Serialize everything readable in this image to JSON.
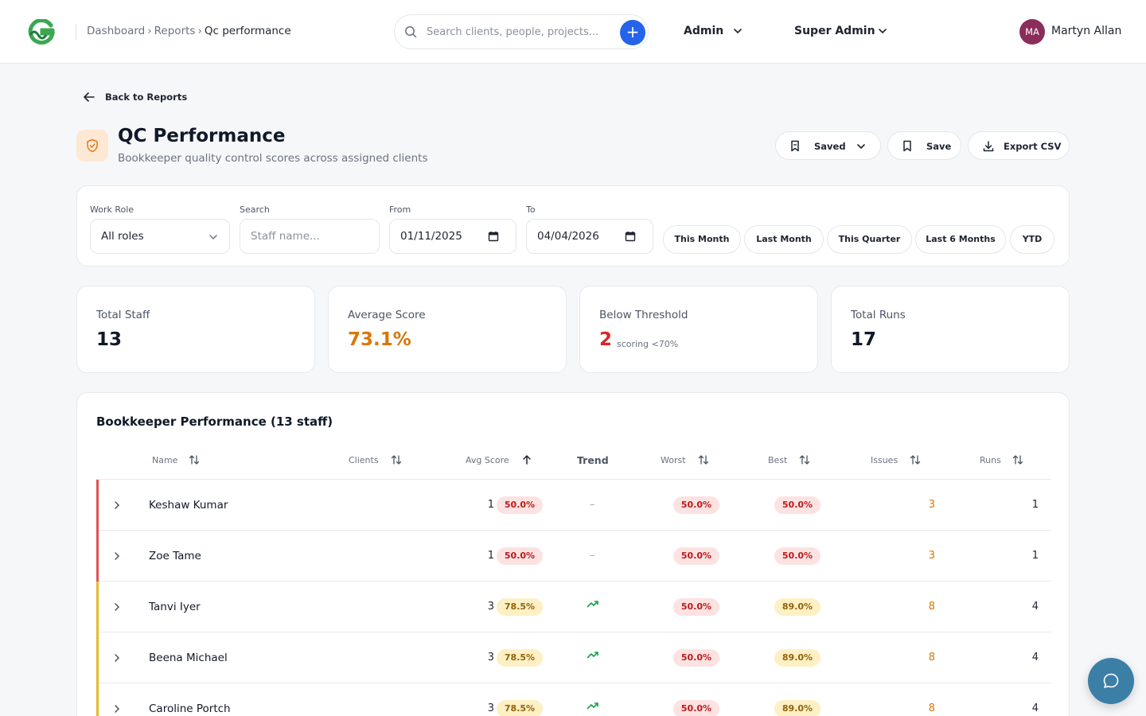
{
  "header": {
    "breadcrumb": [
      "Dashboard",
      "Reports",
      "Qc performance"
    ],
    "breadcrumb_sep": "›",
    "search_placeholder": "Search clients, people, projects...",
    "menu_admin": "Admin",
    "menu_super_admin": "Super Admin",
    "user_initials": "MA",
    "user_name": "Martyn Allan"
  },
  "page": {
    "back_label": "Back to Reports",
    "title": "QC Performance",
    "subtitle": "Bookkeeper quality control scores across assigned clients",
    "saved_label": "Saved",
    "save_label": "Save",
    "export_label": "Export CSV"
  },
  "filters": {
    "work_role_label": "Work Role",
    "work_role_value": "All roles",
    "search_label": "Search",
    "search_placeholder": "Staff name...",
    "from_label": "From",
    "from_value": "01/11/2025",
    "to_label": "To",
    "to_value": "04/04/2026",
    "presets": [
      "This Month",
      "Last Month",
      "This Quarter",
      "Last 6 Months",
      "YTD"
    ]
  },
  "stats": [
    {
      "label": "Total Staff",
      "value": "13",
      "note": ""
    },
    {
      "label": "Average Score",
      "value": "73.1%",
      "note": ""
    },
    {
      "label": "Below Threshold",
      "value": "2",
      "note": "scoring <70%"
    },
    {
      "label": "Total Runs",
      "value": "17",
      "note": ""
    }
  ],
  "table": {
    "title": "Bookkeeper Performance (13 staff)",
    "columns": {
      "name": "Name",
      "clients": "Clients",
      "avg": "Avg Score",
      "trend": "Trend",
      "worst": "Worst",
      "best": "Best",
      "issues": "Issues",
      "runs": "Runs"
    },
    "rows": [
      {
        "name": "Keshaw Kumar",
        "clients": "1",
        "avg": "50.0%",
        "trend": "–",
        "worst": "50.0%",
        "best": "50.0%",
        "issues": "3",
        "runs": "1",
        "status": "red"
      },
      {
        "name": "Zoe Tame",
        "clients": "1",
        "avg": "50.0%",
        "trend": "–",
        "worst": "50.0%",
        "best": "50.0%",
        "issues": "3",
        "runs": "1",
        "status": "red"
      },
      {
        "name": "Tanvi Iyer",
        "clients": "3",
        "avg": "78.5%",
        "trend": "up",
        "worst": "50.0%",
        "best": "89.0%",
        "issues": "8",
        "runs": "4",
        "status": "amber"
      },
      {
        "name": "Beena Michael",
        "clients": "3",
        "avg": "78.5%",
        "trend": "up",
        "worst": "50.0%",
        "best": "89.0%",
        "issues": "8",
        "runs": "4",
        "status": "amber"
      },
      {
        "name": "Caroline Portch",
        "clients": "3",
        "avg": "78.5%",
        "trend": "up",
        "worst": "50.0%",
        "best": "89.0%",
        "issues": "8",
        "runs": "4",
        "status": "amber"
      }
    ]
  },
  "colors": {
    "primary": "#2563eb",
    "danger": "#dc2626",
    "warning": "#d97706",
    "success": "#16a34a",
    "row_red": "#e05252",
    "row_amber": "#e8b92e"
  },
  "icons": {
    "logo": "brand-g-logo",
    "search": "search-icon",
    "plus": "plus-icon",
    "chevron": "chevron-down-icon",
    "back": "arrow-left-icon",
    "title": "shield-check-icon",
    "bookmark": "bookmark-icon",
    "download": "download-icon",
    "calendar": "calendar-icon",
    "sort": "sort-icon",
    "trend_up": "trend-up-icon",
    "chat": "chat-bubble-icon"
  }
}
